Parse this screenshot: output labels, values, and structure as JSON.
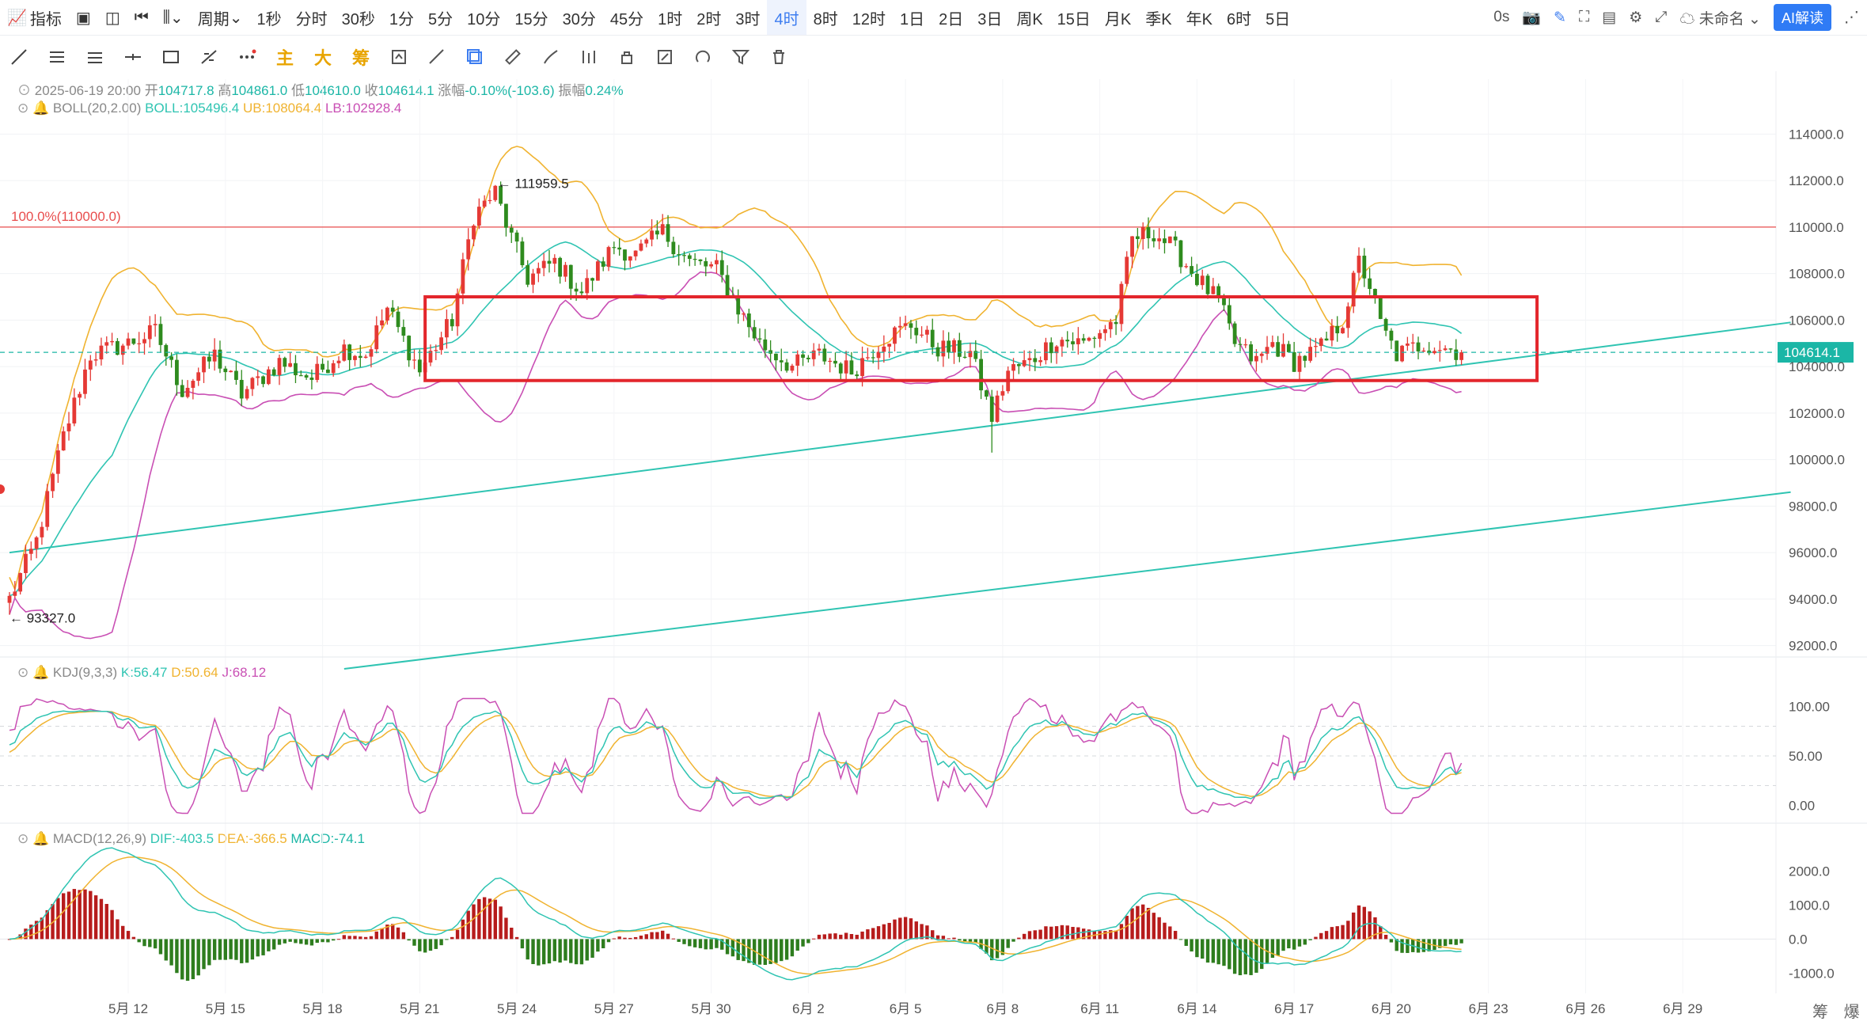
{
  "toolbar": {
    "indicator_label": "指标",
    "period_label": "周期",
    "periods": [
      "1秒",
      "分时",
      "30秒",
      "1分",
      "5分",
      "10分",
      "15分",
      "30分",
      "45分",
      "1时",
      "2时",
      "3时",
      "4时",
      "8时",
      "12时",
      "1日",
      "2日",
      "3日",
      "周K",
      "15日",
      "月K",
      "季K",
      "年K",
      "6时",
      "5日"
    ],
    "active_period": "4时",
    "latency": "0s",
    "unnamed": "未命名",
    "ai_button": "AI解读"
  },
  "drawing_tools": {
    "main": "主",
    "big": "大",
    "chip": "筹"
  },
  "ohlc_bar": {
    "date": "2025-06-19 20:00",
    "open_label": "开",
    "open": "104717.8",
    "high_label": "高",
    "high": "104861.0",
    "low_label": "低",
    "low": "104610.0",
    "close_label": "收",
    "close": "104614.1",
    "change_label": "涨幅",
    "change": "-0.10%(-103.6)",
    "amp_label": "振幅",
    "amp": "0.24%"
  },
  "boll_bar": {
    "name": "BOLL(20,2.00)",
    "boll": "BOLL:105496.4",
    "ub": "UB:108064.4",
    "lb": "LB:102928.4"
  },
  "kdj_bar": {
    "name": "KDJ(9,3,3)",
    "k": "K:56.47",
    "d": "D:50.64",
    "j": "J:68.12"
  },
  "macd_bar": {
    "name": "MACD(12,26,9)",
    "dif": "DIF:-403.5",
    "dea": "DEA:-366.5",
    "macd": "MACD:-74.1"
  },
  "colors": {
    "up": "#e53935",
    "down": "#2e8b1e",
    "boll_mid": "#2fc4b2",
    "boll_ub": "#f0b330",
    "boll_lb": "#c94fb4",
    "trend": "#2fc4b2",
    "box": "#e3262c",
    "fib": "#e84d4d",
    "last_price_bg": "#1bb6a6"
  },
  "bottom_right": {
    "a": "筹",
    "b": "爆"
  },
  "chart_data": {
    "type": "candlestick",
    "symbol_interval": "4H",
    "price_axis": {
      "ticks": [
        114000,
        112000,
        110000,
        108000,
        106000,
        104000,
        102000,
        100000,
        98000,
        96000,
        94000,
        92000
      ],
      "ylim": [
        91000,
        115000
      ]
    },
    "price_axis_labels": [
      "114000.0",
      "112000.0",
      "110000.0",
      "108000.0",
      "106000.0",
      "104000.0",
      "102000.0",
      "100000.0",
      "98000.0",
      "96000.0",
      "94000.0",
      "92000.0"
    ],
    "last_price_label": "104614.1",
    "x_labels": [
      "5月 12",
      "5月 15",
      "5月 18",
      "5月 21",
      "5月 24",
      "5月 27",
      "5月 30",
      "6月 2",
      "6月 5",
      "6月 8",
      "6月 11",
      "6月 14",
      "6月 17",
      "6月 20",
      "6月 23",
      "6月 26",
      "6月 29"
    ],
    "x_label_bars": [
      22,
      40,
      58,
      76,
      94,
      112,
      130,
      148,
      166,
      184,
      202,
      220,
      238,
      256,
      274,
      292,
      310
    ],
    "annotations": {
      "high_marker": "111959.5",
      "low_marker": "93327.0",
      "fib_label": "100.0%(110000.0)",
      "fib_level": 110000
    },
    "bars_count": 270,
    "path_anchors": [
      [
        0,
        94000
      ],
      [
        5,
        96500
      ],
      [
        10,
        101000
      ],
      [
        15,
        104500
      ],
      [
        22,
        105000
      ],
      [
        27,
        105500
      ],
      [
        32,
        103000
      ],
      [
        38,
        104500
      ],
      [
        43,
        102800
      ],
      [
        50,
        104200
      ],
      [
        56,
        103500
      ],
      [
        62,
        104800
      ],
      [
        66,
        104500
      ],
      [
        70,
        106500
      ],
      [
        76,
        103800
      ],
      [
        82,
        106000
      ],
      [
        86,
        110500
      ],
      [
        90,
        111500
      ],
      [
        93,
        109500
      ],
      [
        96,
        107800
      ],
      [
        101,
        108500
      ],
      [
        106,
        107200
      ],
      [
        112,
        109200
      ],
      [
        116,
        108800
      ],
      [
        121,
        109800
      ],
      [
        126,
        108500
      ],
      [
        131,
        108200
      ],
      [
        135,
        106500
      ],
      [
        139,
        105000
      ],
      [
        145,
        104000
      ],
      [
        150,
        104500
      ],
      [
        156,
        103800
      ],
      [
        162,
        105200
      ],
      [
        167,
        105800
      ],
      [
        172,
        104800
      ],
      [
        178,
        104600
      ],
      [
        182,
        101800
      ],
      [
        185,
        103800
      ],
      [
        189,
        104200
      ],
      [
        194,
        105200
      ],
      [
        199,
        105000
      ],
      [
        205,
        106000
      ],
      [
        208,
        109500
      ],
      [
        212,
        109800
      ],
      [
        216,
        109000
      ],
      [
        220,
        107800
      ],
      [
        224,
        106800
      ],
      [
        227,
        105000
      ],
      [
        231,
        104200
      ],
      [
        234,
        105000
      ],
      [
        238,
        104200
      ],
      [
        243,
        104800
      ],
      [
        247,
        106000
      ],
      [
        250,
        108500
      ],
      [
        252,
        107500
      ],
      [
        254,
        105800
      ],
      [
        257,
        104500
      ],
      [
        262,
        105000
      ],
      [
        266,
        104800
      ],
      [
        269,
        104614
      ]
    ],
    "kdj": {
      "overbought": 80,
      "mid": 50,
      "oversold": 20,
      "ticks": [
        100,
        50,
        0
      ],
      "tick_labels": [
        "100.00",
        "50.00",
        "0.00"
      ],
      "last": {
        "K": 56.47,
        "D": 50.64,
        "J": 68.12
      }
    },
    "macd": {
      "ticks": [
        2000,
        1000,
        0,
        -1000
      ],
      "tick_labels": [
        "2000.0",
        "1000.0",
        "0.0",
        "-1000.0"
      ],
      "last": {
        "DIF": -403.5,
        "DEA": -366.5,
        "MACD": -74.1
      }
    },
    "support_lines": [
      {
        "name": "",
        "from": [
          0,
          96000
        ],
        "to": [
          330,
          105900
        ]
      },
      {
        "name": "",
        "from": [
          62,
          91000
        ],
        "to": [
          330,
          98600
        ]
      }
    ],
    "range_box": {
      "top": 107000,
      "bottom": 103400,
      "from_bar": 77,
      "to_bar": 283
    }
  }
}
